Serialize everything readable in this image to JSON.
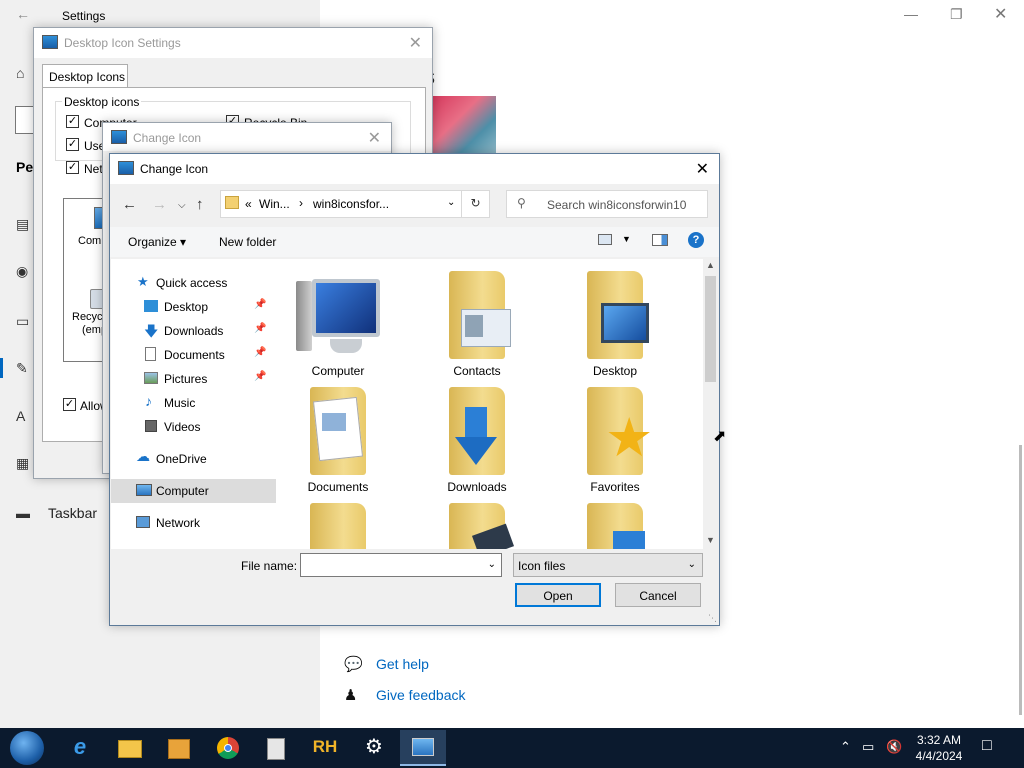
{
  "settings": {
    "title": "Settings",
    "back_icon": "back-arrow-icon",
    "per_text": "Per",
    "heading_fragment": "s",
    "taskbar_label": "Taskbar",
    "links": [
      "Get help",
      "Give feedback"
    ],
    "nav_icons": [
      "home-icon",
      "image-icon",
      "palette-icon",
      "monitor-icon",
      "pen-icon",
      "font-icon",
      "start-icon",
      "taskbar-icon"
    ]
  },
  "desktop_icon_settings": {
    "title": "Desktop Icon Settings",
    "tab": "Desktop Icons",
    "group_label": "Desktop icons",
    "checkboxes": [
      {
        "label": "Computer",
        "checked": true
      },
      {
        "label": "User",
        "checked": true
      },
      {
        "label": "Netw",
        "checked": true
      },
      {
        "label": "Recycle Bin",
        "checked": true
      }
    ],
    "icon_labels": [
      "Compu",
      "Recycle",
      "(empt"
    ],
    "allow_label": "Allow t",
    "allow_checked": true
  },
  "change_icon_back": {
    "title": "Change Icon"
  },
  "change_icon": {
    "title": "Change Icon",
    "address": {
      "prefix": "«",
      "segment1": "Win...",
      "separator": "›",
      "segment2": "win8iconsfor..."
    },
    "search_placeholder": "Search win8iconsforwin10",
    "toolbar": {
      "organize": "Organize ▾",
      "new_folder": "New folder"
    },
    "nav": [
      {
        "label": "Quick access",
        "icon": "star-icon",
        "pinned": false,
        "selected": false
      },
      {
        "label": "Desktop",
        "icon": "desktop-folder-icon",
        "pinned": true,
        "selected": false
      },
      {
        "label": "Downloads",
        "icon": "download-icon",
        "pinned": true,
        "selected": false
      },
      {
        "label": "Documents",
        "icon": "document-icon",
        "pinned": true,
        "selected": false
      },
      {
        "label": "Pictures",
        "icon": "pictures-icon",
        "pinned": true,
        "selected": false
      },
      {
        "label": "Music",
        "icon": "music-icon",
        "pinned": false,
        "selected": false
      },
      {
        "label": "Videos",
        "icon": "video-icon",
        "pinned": false,
        "selected": false
      },
      {
        "label": "OneDrive",
        "icon": "cloud-icon",
        "pinned": false,
        "selected": false
      },
      {
        "label": "Computer",
        "icon": "computer-icon",
        "pinned": false,
        "selected": true
      },
      {
        "label": "Network",
        "icon": "network-icon",
        "pinned": false,
        "selected": false
      }
    ],
    "files": [
      "Computer",
      "Contacts",
      "Desktop",
      "Documents",
      "Downloads",
      "Favorites",
      "",
      "",
      ""
    ],
    "file_name_label": "File name:",
    "file_name_value": "",
    "file_type": "Icon files",
    "open": "Open",
    "cancel": "Cancel"
  },
  "taskbar": {
    "apps": [
      "start-orb-icon",
      "internet-explorer-icon",
      "file-explorer-icon",
      "media-player-icon",
      "chrome-icon",
      "documents-stack-icon",
      "rh-app-icon",
      "settings-gear-icon",
      "change-icon-app-icon"
    ],
    "rh_label": "RH",
    "time": "3:32 AM",
    "date": "4/4/2024"
  },
  "colors": {
    "accent": "#0078d7",
    "link": "#0067c0",
    "taskbar": "#0b1a2e",
    "folder": "#f3dc8f"
  }
}
